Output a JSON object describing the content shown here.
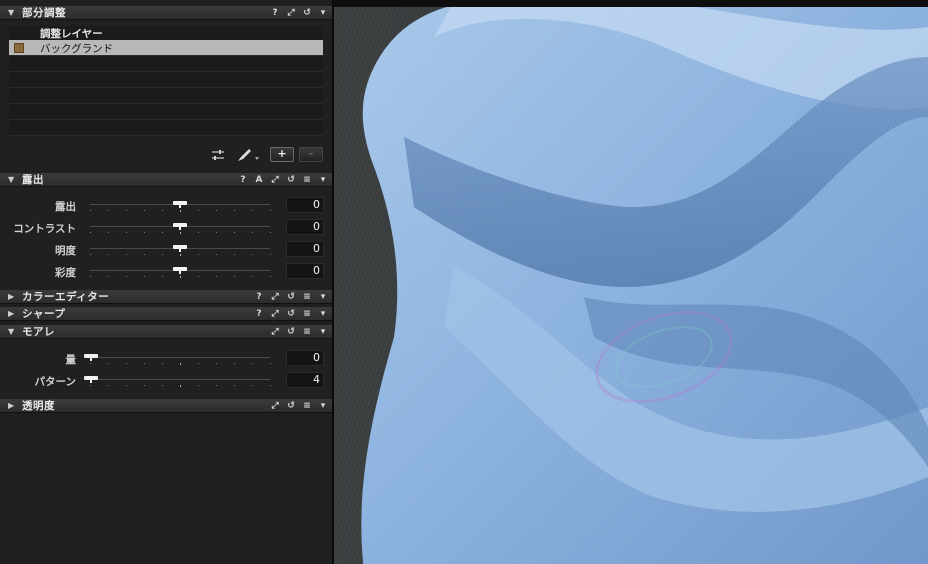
{
  "local_adjustments": {
    "title": "部分調整",
    "column_header": "調整レイヤー",
    "layers": [
      {
        "name": "バックグランド",
        "checked": true,
        "selected": true
      }
    ],
    "add_label": "+",
    "remove_label": "-",
    "header_icons": [
      "help-icon",
      "pop-out-icon",
      "reset-icon",
      "menu-arrow-icon"
    ]
  },
  "exposure": {
    "title": "露出",
    "header_icons": [
      "help-icon",
      "auto-icon",
      "pop-out-icon",
      "reset-icon",
      "presets-icon",
      "menu-arrow-icon"
    ],
    "auto_label": "A",
    "sliders": [
      {
        "label": "露出",
        "value": "0",
        "level": 0.5
      },
      {
        "label": "コントラスト",
        "value": "0",
        "level": 0.5
      },
      {
        "label": "明度",
        "value": "0",
        "level": 0.5
      },
      {
        "label": "彩度",
        "value": "0",
        "level": 0.5
      }
    ]
  },
  "color_editor": {
    "title": "カラーエディター",
    "expanded": false
  },
  "sharpening": {
    "title": "シャープ",
    "expanded": false
  },
  "moire": {
    "title": "モアレ",
    "expanded": true,
    "sliders": [
      {
        "label": "量",
        "value": "0",
        "level": 0.0
      },
      {
        "label": "パターン",
        "value": "4",
        "level": 0.0
      }
    ]
  },
  "opacity": {
    "title": "透明度",
    "expanded": false
  },
  "icons": {
    "collapse": "▼",
    "expand": "▶",
    "help": "?",
    "popout": "⤢",
    "reset": "↺",
    "presets": "≡",
    "menu": "▾"
  },
  "colors": {
    "panel_bg": "#1f1f1f",
    "header_bg": "#343434",
    "selection": "#b8b8b8",
    "fabric_blue": "#8fb6e2"
  }
}
